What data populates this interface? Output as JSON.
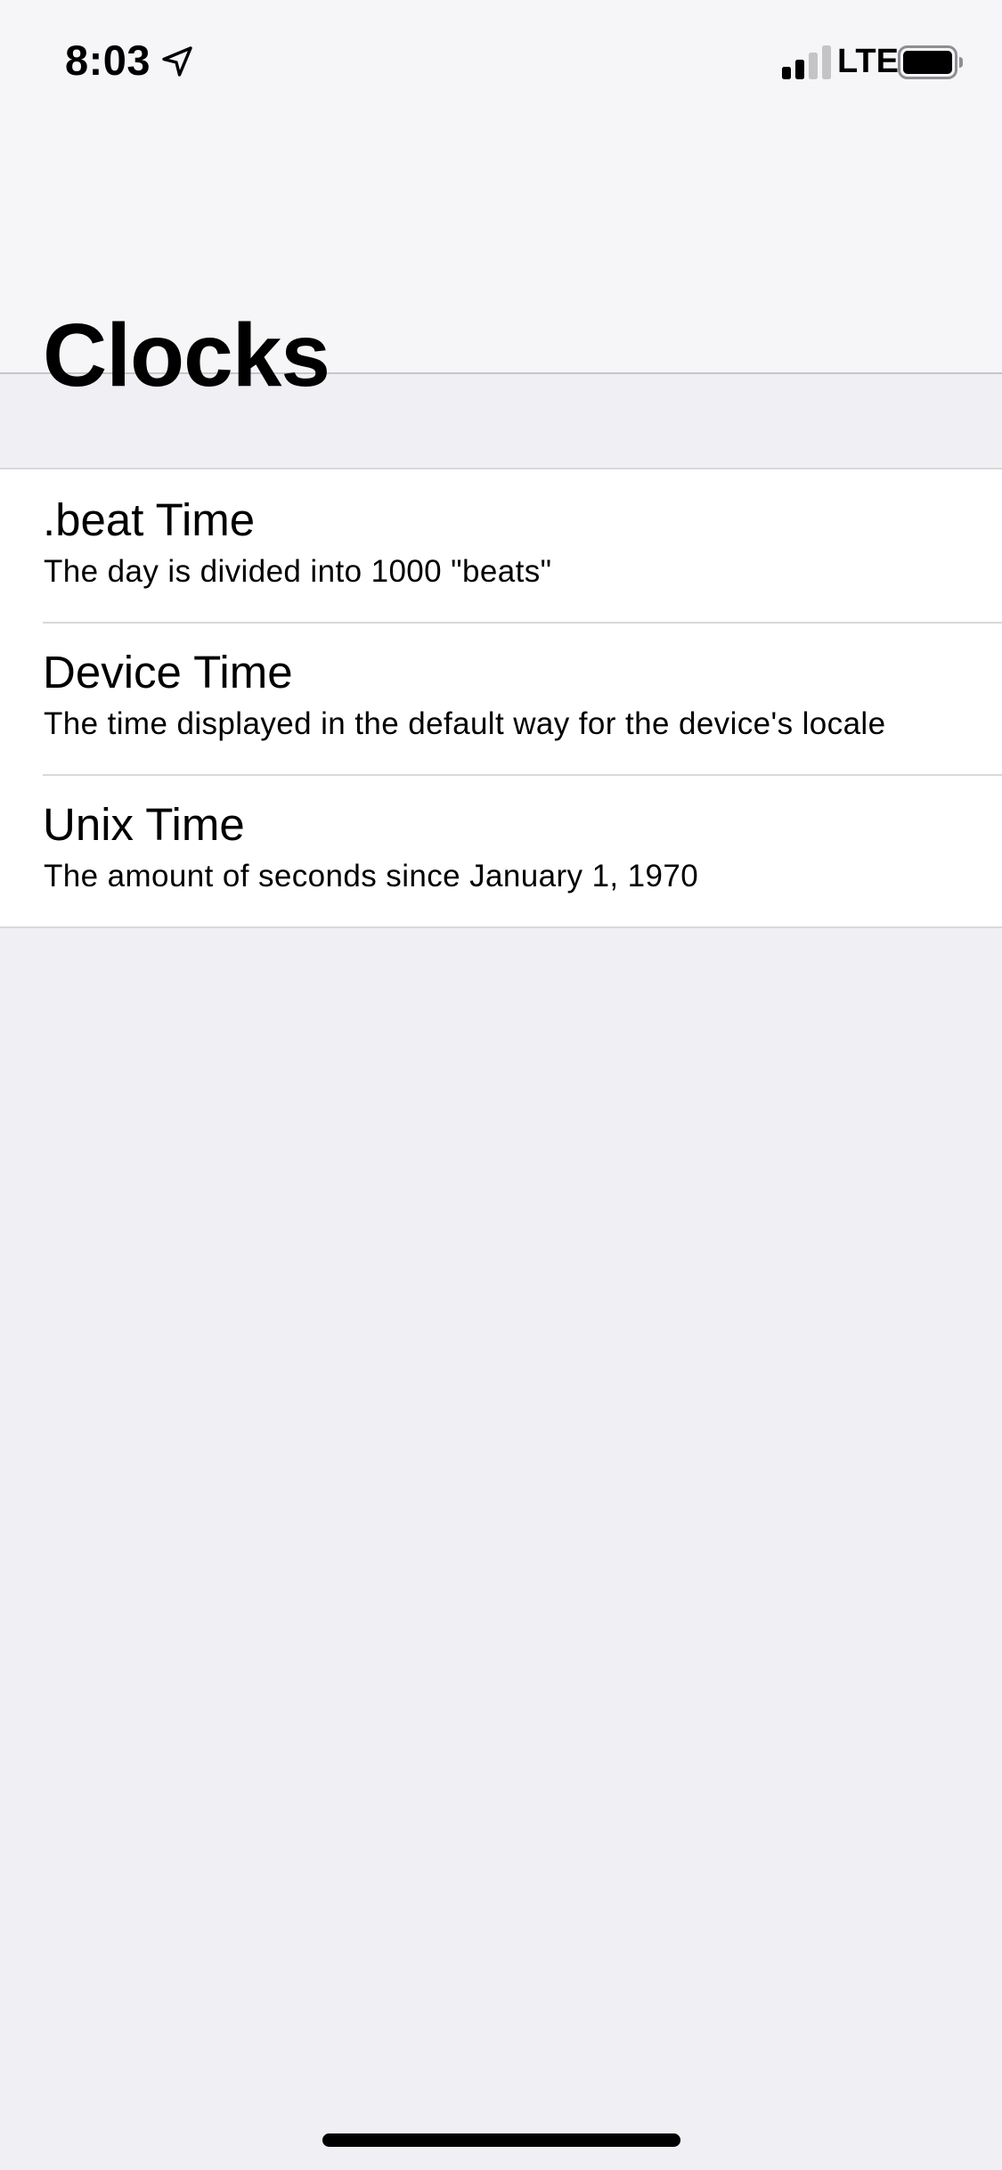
{
  "status_bar": {
    "time": "8:03",
    "network": "LTE",
    "location_icon": "location-arrow-icon",
    "signal_icon": "cellular-signal-icon",
    "signal_bars_filled": 2,
    "signal_bars_total": 4,
    "battery_icon": "battery-full-icon",
    "battery_level": 1.0
  },
  "navigation": {
    "title": "Clocks"
  },
  "clocks": [
    {
      "title": ".beat Time",
      "subtitle": "The day is divided into 1000 \"beats\""
    },
    {
      "title": "Device Time",
      "subtitle": "The time displayed in the default way for the device's locale"
    },
    {
      "title": "Unix Time",
      "subtitle": "The amount of seconds since January 1, 1970"
    }
  ],
  "colors": {
    "header_background": "#f6f6f8",
    "page_background": "#efeff4",
    "separator": "#d8d8dc",
    "text": "#000000"
  }
}
